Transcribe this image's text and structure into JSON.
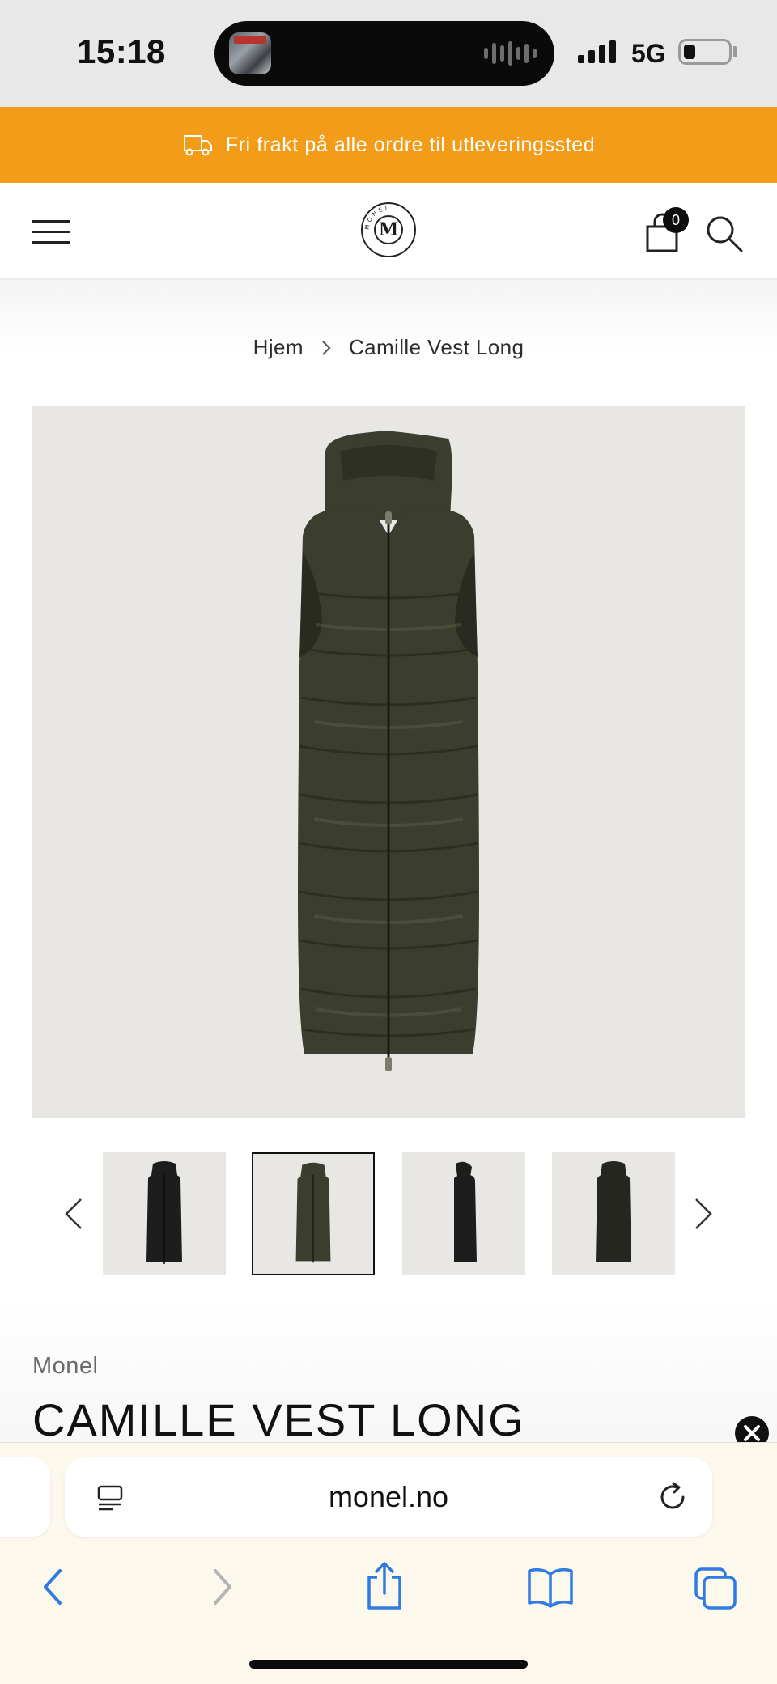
{
  "status_bar": {
    "time": "15:18",
    "network": "5G"
  },
  "promo": {
    "text": "Fri frakt på alle ordre til utleveringssted"
  },
  "header": {
    "logo_letter": "M",
    "logo_ring_text": "MONEL",
    "cart_count": "0"
  },
  "breadcrumb": {
    "home": "Hjem",
    "current": "Camille Vest Long"
  },
  "product": {
    "brand": "Monel",
    "title": "CAMILLE VEST LONG",
    "selected_thumbnail": 2
  },
  "browser": {
    "url": "monel.no"
  },
  "colors": {
    "promo_bg": "#f29c1a",
    "product_olive": "#3b3d2e",
    "product_black": "#1d1d1d",
    "image_bg": "#e8e7e4",
    "safari_accent": "#2f7be0"
  },
  "icons": {
    "menu": "hamburger-icon",
    "cart": "shopping-bag-icon",
    "search": "search-icon",
    "truck": "truck-icon",
    "prev": "chevron-left-icon",
    "next": "chevron-right-icon",
    "close": "close-icon",
    "reader": "reader-icon",
    "reload": "reload-icon",
    "share": "share-icon",
    "bookmarks": "book-icon",
    "tabs": "tabs-icon"
  }
}
